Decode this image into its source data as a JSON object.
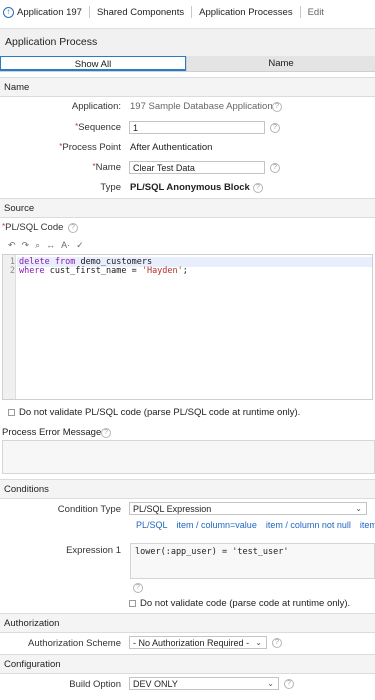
{
  "breadcrumb": {
    "app": "Application 197",
    "shared": "Shared Components",
    "processes": "Application Processes",
    "current": "Edit"
  },
  "page_title": "Application Process",
  "tabs": [
    "Show All",
    "Name"
  ],
  "sections": {
    "name": "Name",
    "source": "Source",
    "conditions": "Conditions",
    "authorization": "Authorization",
    "configuration": "Configuration"
  },
  "name_section": {
    "application_label": "Application:",
    "application_value": "197 Sample Database Application",
    "sequence_label": "Sequence",
    "sequence_value": "1",
    "process_point_label": "Process Point",
    "process_point_value": "After Authentication",
    "name_label": "Name",
    "name_value": "Clear Test Data",
    "type_label": "Type",
    "type_value": "PL/SQL Anonymous Block"
  },
  "source_section": {
    "code_label": "PL/SQL Code",
    "line_numbers": [
      "1",
      "2"
    ],
    "code": {
      "l1_kw1": "delete",
      "l1_kw2": "from",
      "l1_rest": " demo_customers",
      "l2_kw": "where",
      "l2_rest": " cust_first_name = ",
      "l2_str": "'Hayden'",
      "l2_end": ";"
    },
    "no_validate_label": "Do not validate PL/SQL code (parse PL/SQL code at runtime only).",
    "error_message_label": "Process Error Message"
  },
  "conditions_section": {
    "condition_type_label": "Condition Type",
    "condition_type_value": "PL/SQL Expression",
    "links": [
      "PL/SQL",
      "item / column=value",
      "item / column not null",
      "item"
    ],
    "expression_label": "Expression 1",
    "expression_value": "lower(:app_user) = 'test_user'",
    "no_validate_label": "Do not validate code (parse code at runtime only)."
  },
  "authorization_section": {
    "scheme_label": "Authorization Scheme",
    "scheme_value": "- No Authorization Required -"
  },
  "configuration_section": {
    "build_option_label": "Build Option",
    "build_option_value": "DEV ONLY"
  },
  "icons": {
    "home": "home-icon",
    "help": "help-icon",
    "undo": "undo-icon",
    "redo": "redo-icon",
    "search": "search-icon",
    "replace": "replace-icon",
    "autocomplete": "autocomplete-icon",
    "validate": "validate-icon",
    "dropdown": "chevron-down-icon"
  },
  "colors": {
    "accent": "#2a7ac8",
    "required": "#c0392b",
    "link": "#2166c2",
    "keyword": "#8a1ab2",
    "string": "#b5312c"
  }
}
